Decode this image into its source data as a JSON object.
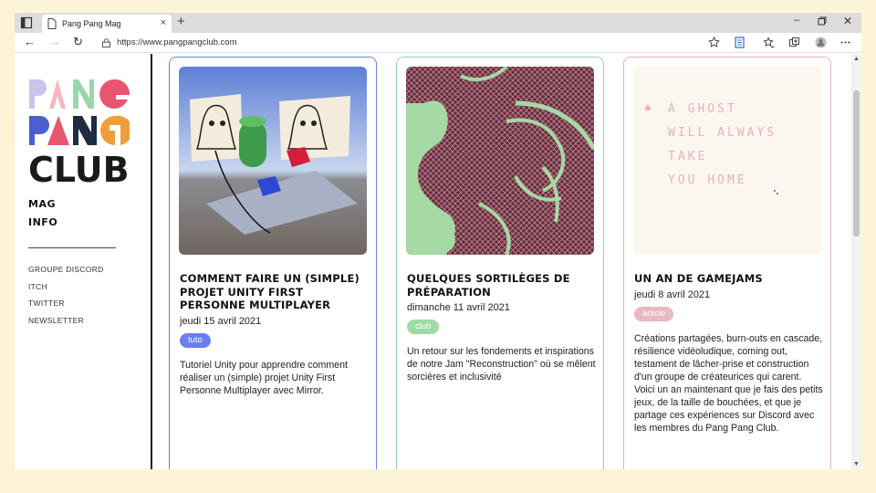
{
  "browser": {
    "tab_title": "Pang Pang Mag",
    "new_tab": "+",
    "close_tab": "×",
    "url": "https://www.pangpangclub.com",
    "win_min": "–",
    "win_close": "✕",
    "back": "←",
    "forward": "→",
    "reload": "↻"
  },
  "logo_text": [
    "PANG",
    "PANG",
    "CLUB"
  ],
  "nav": {
    "mag": "MAG",
    "info": "INFO"
  },
  "links": [
    "GROUPE DISCORD",
    "ITCH",
    "TWITTER",
    "NEWSLETTER"
  ],
  "cards": [
    {
      "title": "COMMENT FAIRE UN (SIMPLE) PROJET UNITY FIRST PERSONNE MULTIPLAYER",
      "date": "jeudi 15 avril 2021",
      "tag": "tuto",
      "description": "Tutoriel Unity pour apprendre comment réaliser un (simple) projet Unity First Personne Multiplayer avec Mirror.",
      "border_color": "#6a7fe0",
      "tag_color": "#6b7ff0"
    },
    {
      "title": "QUELQUES SORTILÈGES DE PRÉPARATION",
      "date": "dimanche 11 avril 2021",
      "tag": "club",
      "description": "Un retour sur les fondements et inspirations de notre Jam \"Reconstruction\" où se mêlent sorcières et inclusivité",
      "border_color": "#8fd69a",
      "tag_color": "#9fdca3"
    },
    {
      "title": "UN AN DE GAMEJAMS",
      "date": "jeudi 8 avril 2021",
      "tag": "article",
      "description": "Créations partagées, burn-outs en cascade, résilience vidéoludique, coming out, testament de lâcher-prise et construction d'un groupe de créateurices qui carent.\nVoici un an maintenant que je fais des petits jeux, de la taille de bouchées, et que je partage ces expériences sur Discord avec les membres du Pang Pang Club.",
      "border_color": "#e3b4c2",
      "tag_color": "#eab8c0"
    }
  ],
  "ghost_poem": [
    "A GHOST",
    "WILL ALWAYS",
    "TAKE",
    "YOU HOME"
  ]
}
